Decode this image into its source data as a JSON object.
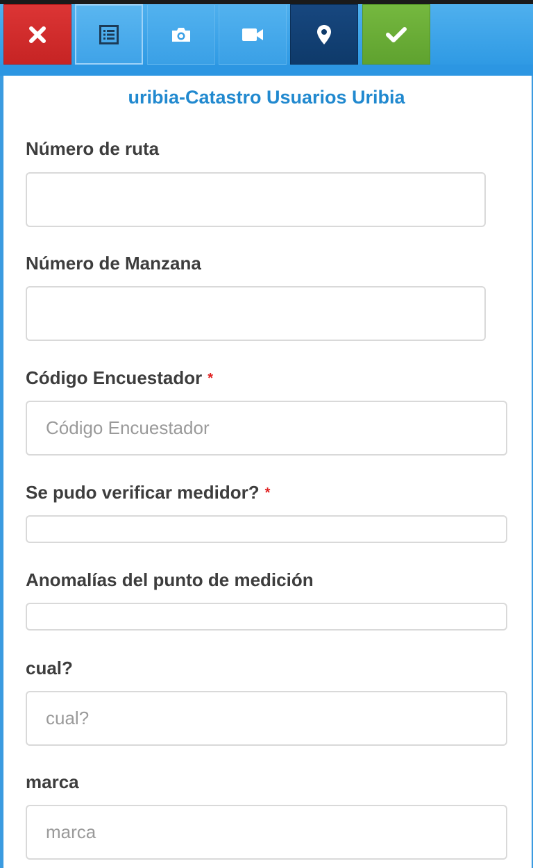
{
  "toolbar": {
    "buttons": [
      {
        "id": "close",
        "icon": "close-icon",
        "color": "#c62424"
      },
      {
        "id": "list",
        "icon": "list-icon",
        "color": "#3fa3e8"
      },
      {
        "id": "camera",
        "icon": "camera-icon",
        "color": "#3aa0e6"
      },
      {
        "id": "video",
        "icon": "video-icon",
        "color": "#3aa0e6"
      },
      {
        "id": "location",
        "icon": "map-marker-icon",
        "color": "#0e3a6a"
      },
      {
        "id": "submit",
        "icon": "check-icon",
        "color": "#5fa22f"
      }
    ]
  },
  "form": {
    "title": "uribia-Catastro Usuarios Uribia",
    "fields": {
      "ruta": {
        "label": "Número de ruta",
        "value": "",
        "placeholder": ""
      },
      "manzana": {
        "label": "Número de Manzana",
        "value": "",
        "placeholder": ""
      },
      "encuestador": {
        "label": "Código Encuestador",
        "required_mark": "*",
        "value": "",
        "placeholder": "Código Encuestador"
      },
      "medidor": {
        "label": "Se pudo verificar medidor?",
        "required_mark": "*",
        "value": ""
      },
      "anomalias": {
        "label": "Anomalías del punto de medición",
        "value": ""
      },
      "cual": {
        "label": "cual?",
        "value": "",
        "placeholder": "cual?"
      },
      "marca": {
        "label": "marca",
        "value": "",
        "placeholder": "marca"
      }
    }
  },
  "colors": {
    "accent": "#2189cf",
    "toolbar": "#3b9be0",
    "required": "#e02020"
  }
}
